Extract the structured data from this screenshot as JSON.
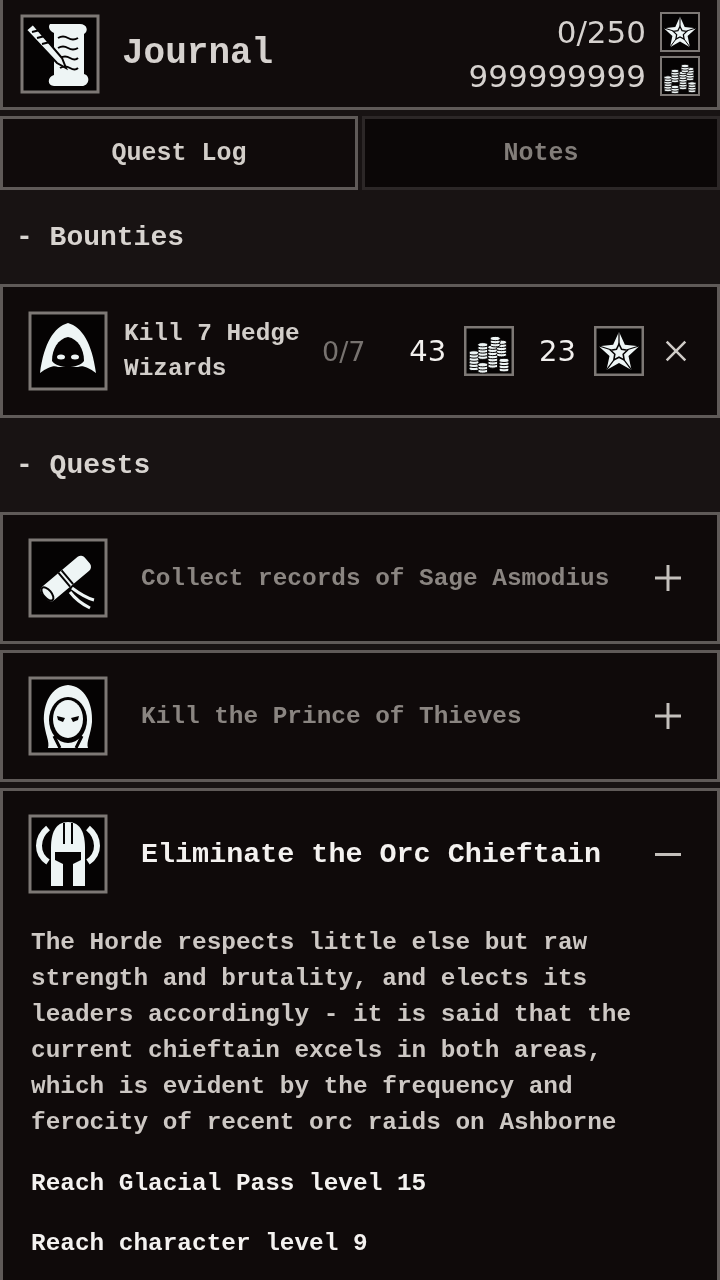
{
  "header": {
    "title": "Journal",
    "currencies": [
      {
        "kind": "star",
        "value": "0/250"
      },
      {
        "kind": "coins",
        "value": "999999999"
      }
    ]
  },
  "tabs": [
    {
      "label": "Quest Log",
      "selected": true
    },
    {
      "label": "Notes",
      "selected": false
    }
  ],
  "bounties": {
    "heading": "- Bounties",
    "items": [
      {
        "kind": "hood",
        "title": "Kill 7 Hedge Wizards",
        "progress": "0/7",
        "complete": false,
        "rewards": [
          {
            "kind": "coins",
            "amount": "43"
          },
          {
            "kind": "star",
            "amount": "23"
          }
        ]
      }
    ]
  },
  "quests": {
    "heading": "- Quests",
    "items": [
      {
        "kind": "scroll",
        "title": "Collect records of Sage Asmodius",
        "expanded": false
      },
      {
        "kind": "cowl",
        "title": "Kill the Prince of Thieves",
        "expanded": false
      },
      {
        "kind": "helmet",
        "title": "Eliminate the Orc Chieftain",
        "expanded": true,
        "description": "The Horde respects little else but raw strength and brutality, and elects its leaders accordingly - it is said that the current chieftain excels in both areas, which is evident by the frequency and ferocity of recent orc raids on Ashborne",
        "requirements": [
          "Reach Glacial Pass level 15",
          "Reach character level 9"
        ]
      }
    ]
  }
}
